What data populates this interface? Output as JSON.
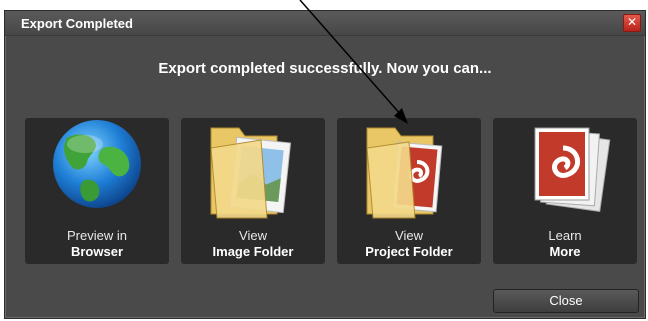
{
  "dialog": {
    "title": "Export Completed",
    "close_glyph": "✕",
    "headline": "Export completed successfully. Now you can...",
    "tiles": [
      {
        "line1": "Preview in",
        "line2": "Browser",
        "icon": "globe-icon"
      },
      {
        "line1": "View",
        "line2": "Image Folder",
        "icon": "image-folder-icon"
      },
      {
        "line1": "View",
        "line2": "Project Folder",
        "icon": "project-folder-icon"
      },
      {
        "line1": "Learn",
        "line2": "More",
        "icon": "documents-icon"
      }
    ],
    "close_label": "Close"
  }
}
